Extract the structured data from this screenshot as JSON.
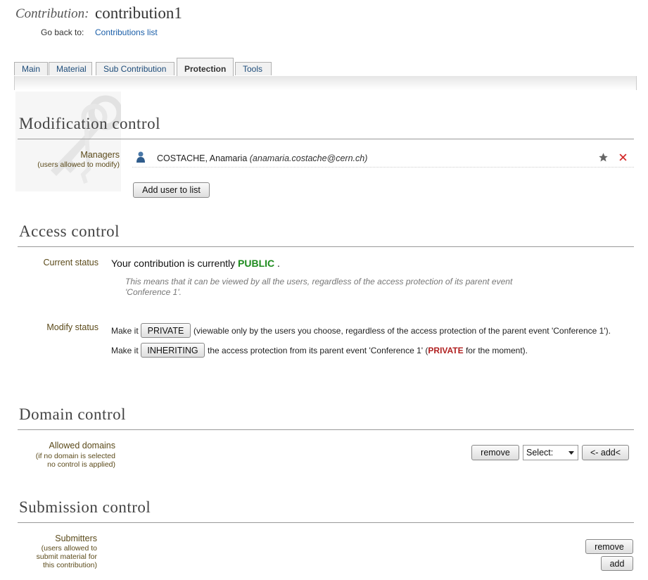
{
  "header": {
    "label": "Contribution:",
    "name": "contribution1",
    "go_back_label": "Go back to:",
    "go_back_link": "Contributions list"
  },
  "tabs": [
    {
      "label": "Main",
      "active": false
    },
    {
      "label": "Material",
      "active": false
    },
    {
      "label": "Sub Contribution",
      "active": false
    },
    {
      "label": "Protection",
      "active": true
    },
    {
      "label": "Tools",
      "active": false
    }
  ],
  "modification": {
    "title": "Modification control",
    "managers_label": "Managers",
    "managers_sub": "(users allowed to modify)",
    "user_name": "COSTACHE, Anamaria",
    "user_email": "(anamaria.costache@cern.ch)",
    "add_button": "Add user to list"
  },
  "access": {
    "title": "Access control",
    "current_label": "Current status",
    "status_prefix": "Your contribution is currently",
    "status_value": "PUBLIC",
    "status_suffix": ".",
    "status_desc": "This means that it can be viewed by all the users, regardless of the access protection of its parent event 'Conference 1'.",
    "modify_label": "Modify status",
    "make_it": "Make it",
    "private_button": "PRIVATE",
    "private_desc": "(viewable only by the users you choose, regardless of the access protection of the parent event 'Conference 1').",
    "inheriting_button": "INHERITING",
    "inheriting_desc_pre": "the access protection from its parent event 'Conference 1' (",
    "inheriting_private": "PRIVATE",
    "inheriting_desc_post": " for the moment)."
  },
  "domain": {
    "title": "Domain control",
    "allowed_label": "Allowed domains",
    "allowed_sub1": "(if no domain is selected",
    "allowed_sub2": "no control is applied)",
    "remove_button": "remove",
    "select_value": "Select:",
    "add_button": "<- add<"
  },
  "submission": {
    "title": "Submission control",
    "submitters_label": "Submitters",
    "sub1": "(users allowed to",
    "sub2": "submit material for",
    "sub3": "this contribution)",
    "remove_button": "remove",
    "add_button": "add"
  },
  "colors": {
    "link": "#1a5ea8",
    "public": "#1e8b1e",
    "private": "#b02020",
    "label": "#5b4a1a"
  }
}
